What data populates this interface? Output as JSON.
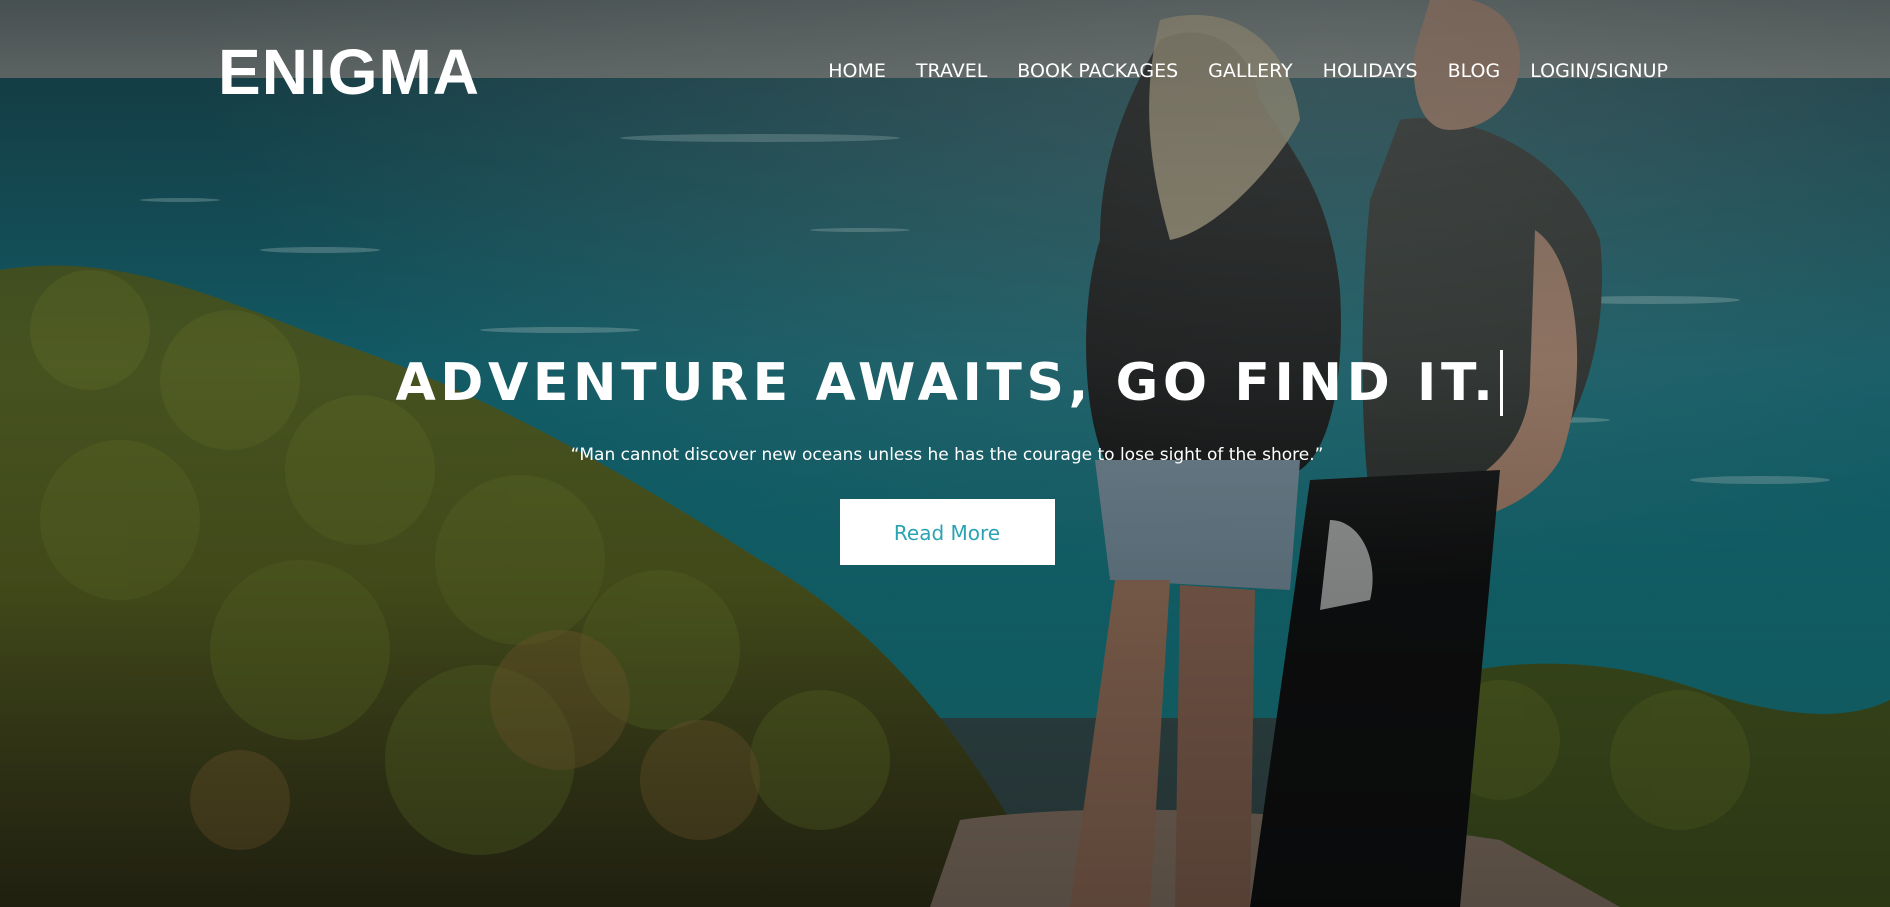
{
  "brand": {
    "logo_text": "ENIGMA"
  },
  "nav": {
    "items": [
      {
        "label": "HOME"
      },
      {
        "label": "TRAVEL"
      },
      {
        "label": "BOOK PACKAGES"
      },
      {
        "label": "GALLERY"
      },
      {
        "label": "HOLIDAYS"
      },
      {
        "label": "BLOG"
      },
      {
        "label": "LOGIN/SIGNUP"
      }
    ]
  },
  "hero": {
    "headline": "ADVENTURE AWAITS, GO FIND IT.",
    "quote": "“Man cannot discover new oceans unless he has the courage to lose sight of the shore.”",
    "cta_label": "Read More"
  },
  "colors": {
    "text": "#ffffff",
    "button_background": "#ffffff",
    "button_text": "#2aa3b3",
    "sea": "#1f6f78",
    "foliage": "#5b6a2a"
  }
}
